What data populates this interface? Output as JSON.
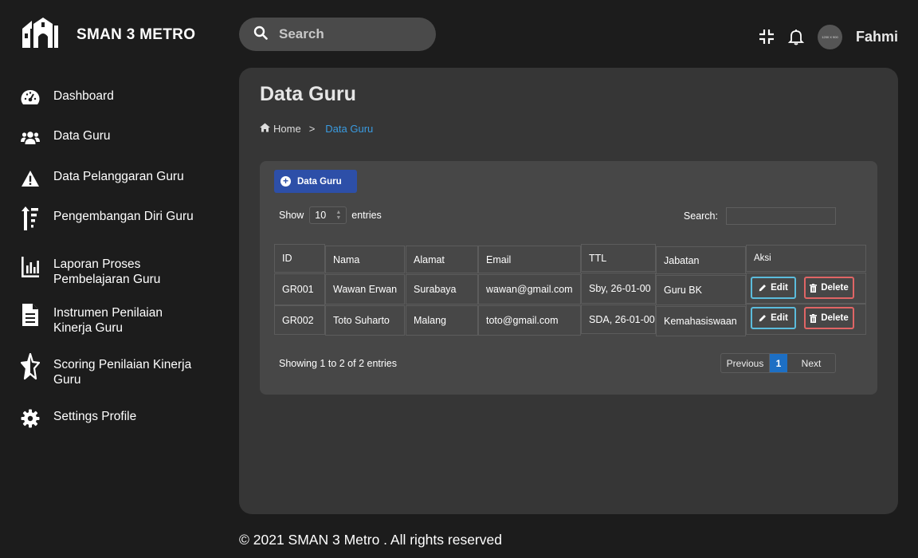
{
  "brand": {
    "name": "SMAN 3 METRO"
  },
  "search": {
    "placeholder": "Search"
  },
  "user": {
    "avatar_text": "1200 X 900",
    "name": "Fahmi"
  },
  "sidebar": {
    "items": [
      {
        "label": "Dashboard",
        "icon": "dashboard-gauge-icon"
      },
      {
        "label": "Data Guru",
        "icon": "users-icon"
      },
      {
        "label": "Data Pelanggaran Guru",
        "icon": "warning-icon"
      },
      {
        "label": "Pengembangan Diri Guru",
        "icon": "sort-amount-up-icon"
      },
      {
        "label": "Laporan Proses Pembelajaran Guru",
        "icon": "bar-chart-icon"
      },
      {
        "label": "Instrumen Penilaian Kinerja Guru",
        "icon": "document-icon"
      },
      {
        "label": "Scoring Penilaian Kinerja Guru",
        "icon": "star-half-icon"
      },
      {
        "label": "Settings Profile",
        "icon": "gear-icon"
      }
    ]
  },
  "main": {
    "title": "Data Guru",
    "breadcrumb": {
      "home": "Home",
      "separator": ">",
      "current": "Data Guru"
    },
    "add_button": "Data Guru",
    "show": {
      "prefix": "Show",
      "value": "10",
      "suffix": "entries"
    },
    "search_label": "Search:",
    "table": {
      "headers": [
        "ID",
        "Nama",
        "Alamat",
        "Email",
        "TTL",
        "Jabatan",
        "Aksi"
      ],
      "rows": [
        [
          "GR001",
          "Wawan Erwan",
          "Surabaya",
          "wawan@gmail.com",
          "Sby, 26-01-00",
          "Guru BK"
        ],
        [
          "GR002",
          "Toto Suharto",
          "Malang",
          "toto@gmail.com",
          "SDA, 26-01-00",
          "Kemahasiswaan"
        ]
      ],
      "edit_label": "Edit",
      "delete_label": "Delete"
    },
    "info": "Showing 1 to 2 of 2 entries",
    "pagination": {
      "previous": "Previous",
      "current": "1",
      "next": "Next"
    }
  },
  "footer": {
    "text": "© 2021 SMAN 3 Metro . All rights reserved"
  },
  "colors": {
    "background": "#1c1c1c",
    "card": "#363636",
    "panel": "#474747",
    "primary": "#2d4fa8",
    "link": "#3a9be0",
    "edit": "#5bbcdc",
    "delete": "#e06565"
  }
}
